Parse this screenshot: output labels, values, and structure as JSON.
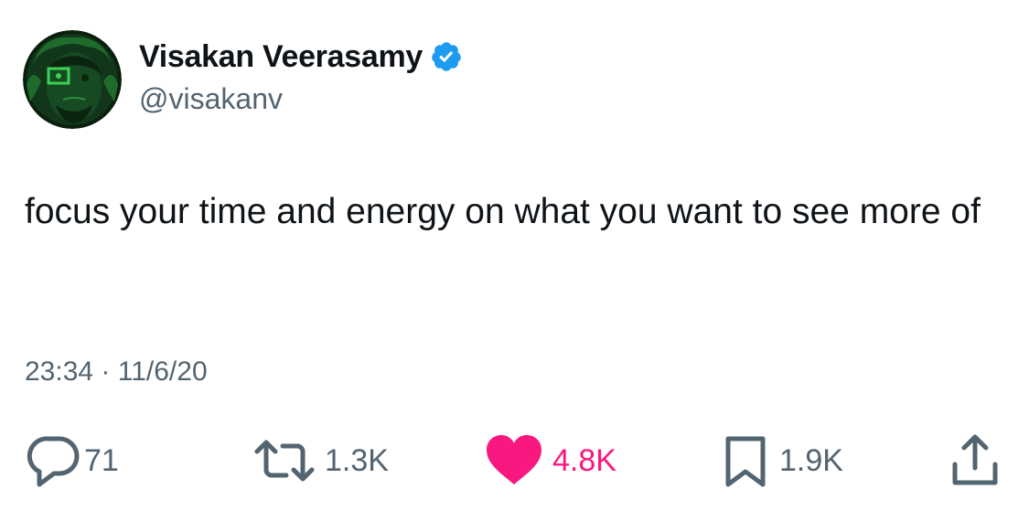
{
  "user": {
    "display_name": "Visakan Veerasamy",
    "handle": "@visakanv",
    "verified": true,
    "avatar_icon": "avatar-green-portrait"
  },
  "tweet": {
    "text": "focus your time and energy on what you want to see more of",
    "time": "23:34",
    "separator": "·",
    "date": "11/6/20"
  },
  "actions": {
    "replies": "71",
    "retweets": "1.3K",
    "likes": "4.8K",
    "bookmarks": "1.9K",
    "liked": true
  },
  "colors": {
    "text": "#0f1419",
    "secondary": "#536471",
    "verified_badge": "#1d9bf0",
    "like": "#f91880"
  },
  "icons": {
    "reply": "reply-icon",
    "retweet": "retweet-icon",
    "like": "heart-icon",
    "bookmark": "bookmark-icon",
    "share": "share-icon",
    "verified": "verified-badge-icon"
  }
}
